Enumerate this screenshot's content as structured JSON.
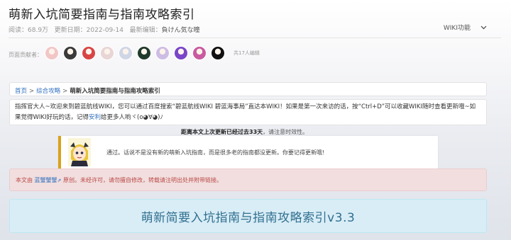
{
  "page": {
    "title": "萌新入坑简要指南与指南攻略索引"
  },
  "meta": {
    "views_label": "阅读：",
    "views_value": "68.9万",
    "updated_label": "更新日期：",
    "updated_value": "2022-09-14",
    "editor_label": "最新编辑：",
    "editor_value": "負けん気な瞳",
    "wiki_func_label": "WIKI功能"
  },
  "contributors": {
    "label": "页面贡献者：",
    "count_text": "共17人编辑",
    "avatar_colors": [
      "#f2c6c6",
      "#3a3a3a",
      "#d84545",
      "#e8d5d5",
      "#cfd6e6",
      "#1f3a2a",
      "#cdbde4",
      "#7a45c8",
      "#c95aa0",
      "#111111"
    ]
  },
  "breadcrumb": {
    "home": "首页",
    "sep": ">",
    "parent": "综合攻略",
    "current": "萌新入坑简要指南与指南攻略索引"
  },
  "notice": {
    "text_before": "指挥官大人~欢迎来到碧蓝航线WIKI，您可以通过百度搜索“碧蓝航线WIKI 碧蓝海事局”直达本WIKI！如果是第一次来访的话，按“Ctrl+D”可以收藏WIKI随时查看更新哦~如果觉得WIKI好玩的话，记得",
    "link_text": "安利",
    "text_after": "给更多人哟ヾ(o◕∀◕)ﾉ"
  },
  "update": {
    "text": "距离本文上次更新已经过去33天",
    "hint": "，请注意时效性。"
  },
  "tip": {
    "text": "通过。话说不是没有新的萌新入坑指南，而是很多老的指南都没更新。你要记得更新哦!"
  },
  "copyright": {
    "prefix": "本文由",
    "author": "蓝蟹蟹蟹",
    "ext_icon": "⇗",
    "suffix": "原创。未经许可，请勿擅自修改，转载请注明出处并附带链接。"
  },
  "banner": {
    "text": "萌新简要入坑指南与指南攻略索引v3.3"
  },
  "colors": {
    "link": "#2f6fbe",
    "tip_accent": "#d9a21b",
    "copyright_bg": "#f2dede",
    "banner_bg": "#d9edf7",
    "banner_text": "#31708f"
  }
}
